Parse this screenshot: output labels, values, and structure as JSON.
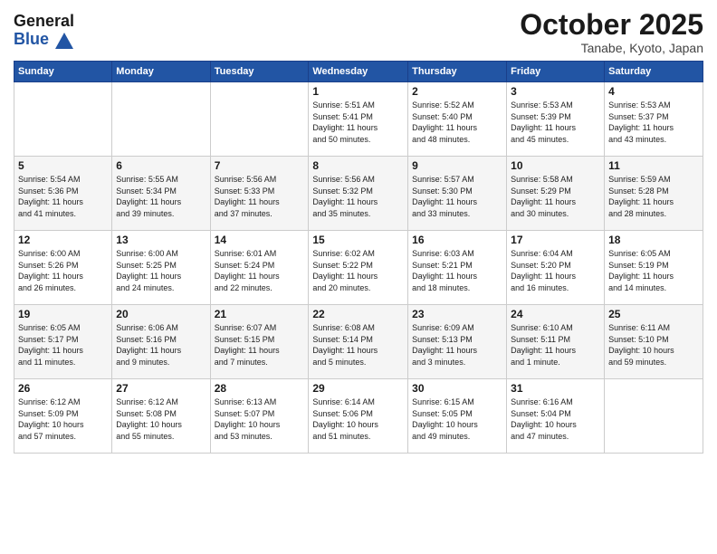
{
  "header": {
    "logo_general": "General",
    "logo_blue": "Blue",
    "month": "October 2025",
    "location": "Tanabe, Kyoto, Japan"
  },
  "weekdays": [
    "Sunday",
    "Monday",
    "Tuesday",
    "Wednesday",
    "Thursday",
    "Friday",
    "Saturday"
  ],
  "weeks": [
    [
      {
        "day": "",
        "info": ""
      },
      {
        "day": "",
        "info": ""
      },
      {
        "day": "",
        "info": ""
      },
      {
        "day": "1",
        "info": "Sunrise: 5:51 AM\nSunset: 5:41 PM\nDaylight: 11 hours\nand 50 minutes."
      },
      {
        "day": "2",
        "info": "Sunrise: 5:52 AM\nSunset: 5:40 PM\nDaylight: 11 hours\nand 48 minutes."
      },
      {
        "day": "3",
        "info": "Sunrise: 5:53 AM\nSunset: 5:39 PM\nDaylight: 11 hours\nand 45 minutes."
      },
      {
        "day": "4",
        "info": "Sunrise: 5:53 AM\nSunset: 5:37 PM\nDaylight: 11 hours\nand 43 minutes."
      }
    ],
    [
      {
        "day": "5",
        "info": "Sunrise: 5:54 AM\nSunset: 5:36 PM\nDaylight: 11 hours\nand 41 minutes."
      },
      {
        "day": "6",
        "info": "Sunrise: 5:55 AM\nSunset: 5:34 PM\nDaylight: 11 hours\nand 39 minutes."
      },
      {
        "day": "7",
        "info": "Sunrise: 5:56 AM\nSunset: 5:33 PM\nDaylight: 11 hours\nand 37 minutes."
      },
      {
        "day": "8",
        "info": "Sunrise: 5:56 AM\nSunset: 5:32 PM\nDaylight: 11 hours\nand 35 minutes."
      },
      {
        "day": "9",
        "info": "Sunrise: 5:57 AM\nSunset: 5:30 PM\nDaylight: 11 hours\nand 33 minutes."
      },
      {
        "day": "10",
        "info": "Sunrise: 5:58 AM\nSunset: 5:29 PM\nDaylight: 11 hours\nand 30 minutes."
      },
      {
        "day": "11",
        "info": "Sunrise: 5:59 AM\nSunset: 5:28 PM\nDaylight: 11 hours\nand 28 minutes."
      }
    ],
    [
      {
        "day": "12",
        "info": "Sunrise: 6:00 AM\nSunset: 5:26 PM\nDaylight: 11 hours\nand 26 minutes."
      },
      {
        "day": "13",
        "info": "Sunrise: 6:00 AM\nSunset: 5:25 PM\nDaylight: 11 hours\nand 24 minutes."
      },
      {
        "day": "14",
        "info": "Sunrise: 6:01 AM\nSunset: 5:24 PM\nDaylight: 11 hours\nand 22 minutes."
      },
      {
        "day": "15",
        "info": "Sunrise: 6:02 AM\nSunset: 5:22 PM\nDaylight: 11 hours\nand 20 minutes."
      },
      {
        "day": "16",
        "info": "Sunrise: 6:03 AM\nSunset: 5:21 PM\nDaylight: 11 hours\nand 18 minutes."
      },
      {
        "day": "17",
        "info": "Sunrise: 6:04 AM\nSunset: 5:20 PM\nDaylight: 11 hours\nand 16 minutes."
      },
      {
        "day": "18",
        "info": "Sunrise: 6:05 AM\nSunset: 5:19 PM\nDaylight: 11 hours\nand 14 minutes."
      }
    ],
    [
      {
        "day": "19",
        "info": "Sunrise: 6:05 AM\nSunset: 5:17 PM\nDaylight: 11 hours\nand 11 minutes."
      },
      {
        "day": "20",
        "info": "Sunrise: 6:06 AM\nSunset: 5:16 PM\nDaylight: 11 hours\nand 9 minutes."
      },
      {
        "day": "21",
        "info": "Sunrise: 6:07 AM\nSunset: 5:15 PM\nDaylight: 11 hours\nand 7 minutes."
      },
      {
        "day": "22",
        "info": "Sunrise: 6:08 AM\nSunset: 5:14 PM\nDaylight: 11 hours\nand 5 minutes."
      },
      {
        "day": "23",
        "info": "Sunrise: 6:09 AM\nSunset: 5:13 PM\nDaylight: 11 hours\nand 3 minutes."
      },
      {
        "day": "24",
        "info": "Sunrise: 6:10 AM\nSunset: 5:11 PM\nDaylight: 11 hours\nand 1 minute."
      },
      {
        "day": "25",
        "info": "Sunrise: 6:11 AM\nSunset: 5:10 PM\nDaylight: 10 hours\nand 59 minutes."
      }
    ],
    [
      {
        "day": "26",
        "info": "Sunrise: 6:12 AM\nSunset: 5:09 PM\nDaylight: 10 hours\nand 57 minutes."
      },
      {
        "day": "27",
        "info": "Sunrise: 6:12 AM\nSunset: 5:08 PM\nDaylight: 10 hours\nand 55 minutes."
      },
      {
        "day": "28",
        "info": "Sunrise: 6:13 AM\nSunset: 5:07 PM\nDaylight: 10 hours\nand 53 minutes."
      },
      {
        "day": "29",
        "info": "Sunrise: 6:14 AM\nSunset: 5:06 PM\nDaylight: 10 hours\nand 51 minutes."
      },
      {
        "day": "30",
        "info": "Sunrise: 6:15 AM\nSunset: 5:05 PM\nDaylight: 10 hours\nand 49 minutes."
      },
      {
        "day": "31",
        "info": "Sunrise: 6:16 AM\nSunset: 5:04 PM\nDaylight: 10 hours\nand 47 minutes."
      },
      {
        "day": "",
        "info": ""
      }
    ]
  ]
}
